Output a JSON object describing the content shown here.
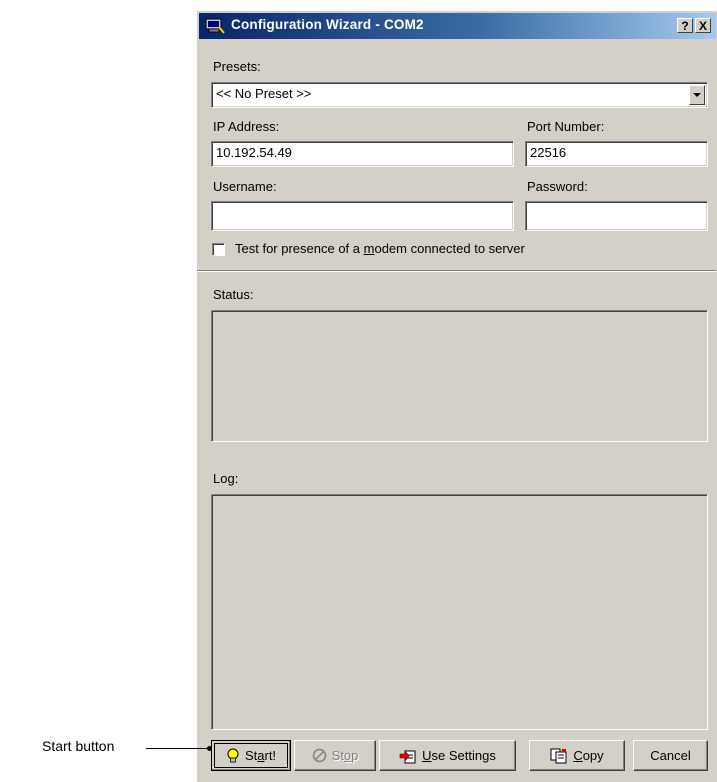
{
  "window": {
    "title": "Configuration Wizard - COM2",
    "help_button": "?",
    "close_button": "X"
  },
  "presets": {
    "label": "Presets:",
    "selected": "<< No Preset >>"
  },
  "ip_address": {
    "label": "IP Address:",
    "value": "10.192.54.49"
  },
  "port_number": {
    "label": "Port Number:",
    "value": "22516"
  },
  "username": {
    "label": "Username:",
    "value": ""
  },
  "password": {
    "label": "Password:",
    "value": ""
  },
  "modem_test": {
    "label_before": "Test for presence of a ",
    "label_underlined": "m",
    "label_after": "odem connected to server",
    "checked": false
  },
  "status": {
    "label": "Status:",
    "content": ""
  },
  "log": {
    "label": "Log:",
    "content": ""
  },
  "buttons": {
    "start": {
      "pre": "St",
      "u": "a",
      "post": "rt!",
      "icon": "lightbulb-icon"
    },
    "stop": {
      "pre": "St",
      "u": "o",
      "post": "p",
      "icon": "stop-icon"
    },
    "use_settings": {
      "pre": "",
      "u": "U",
      "post": "se Settings",
      "icon": "apply-settings-icon"
    },
    "copy": {
      "pre": "",
      "u": "C",
      "post": "opy",
      "icon": "copy-icon"
    },
    "cancel": {
      "label": "Cancel"
    }
  },
  "callout": {
    "label": "Start button"
  },
  "colors": {
    "dialog_face": "#d4d0c8",
    "title_gradient_start": "#0a246a",
    "title_gradient_end": "#a6caf0"
  }
}
